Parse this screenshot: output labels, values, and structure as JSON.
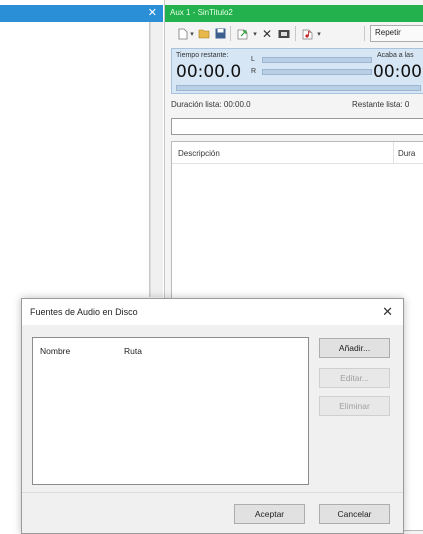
{
  "left_window": {
    "close_glyph": "✕"
  },
  "aux_window": {
    "title": "Aux 1 - SinTitulo2",
    "toolbar": {
      "icons": [
        "new-file-icon",
        "open-folder-icon",
        "save-icon",
        "export-icon",
        "delete-icon",
        "cartwall-icon",
        "music-add-icon"
      ],
      "repeat_label": "Repetir"
    },
    "time_panel": {
      "remaining_label": "Tiempo restante:",
      "remaining_value": "00:00.0",
      "channel_l": "L",
      "channel_r": "R",
      "ends_label": "Acaba a las",
      "ends_value": "00:00:"
    },
    "list_duration": "Duración lista: 00:00.0",
    "list_remaining": "Restante lista: 0",
    "columns": {
      "description": "Descripción",
      "duration": "Dura"
    }
  },
  "dialog": {
    "title": "Fuentes de Audio en Disco",
    "close_glyph": "✕",
    "columns": {
      "name": "Nombre",
      "path": "Ruta"
    },
    "buttons": {
      "add": "Añadir...",
      "edit": "Editar...",
      "remove": "Eliminar",
      "accept": "Aceptar",
      "cancel": "Cancelar"
    }
  }
}
